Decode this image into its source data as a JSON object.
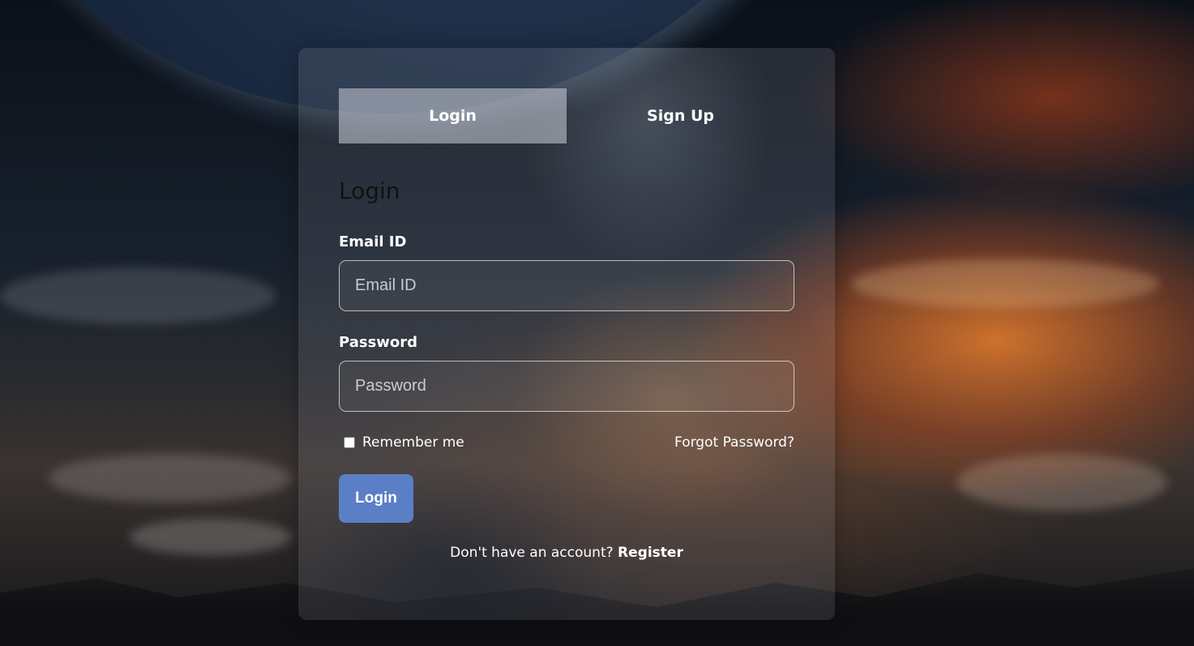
{
  "colors": {
    "primary_button": "#5a7fc6",
    "active_tab": "#cdd2dc",
    "heading_text": "#111111",
    "text": "#ffffff"
  },
  "tabs": [
    {
      "label": "Login",
      "active": true
    },
    {
      "label": "Sign Up",
      "active": false
    }
  ],
  "form": {
    "title": "Login",
    "email": {
      "label": "Email ID",
      "placeholder": "Email ID",
      "value": ""
    },
    "password": {
      "label": "Password",
      "placeholder": "Password",
      "value": ""
    },
    "remember_label": "Remember me",
    "remember_checked": false,
    "forgot_label": "Forgot Password?",
    "submit_label": "Login",
    "register_prompt": "Don't have an account?",
    "register_link": "Register"
  }
}
